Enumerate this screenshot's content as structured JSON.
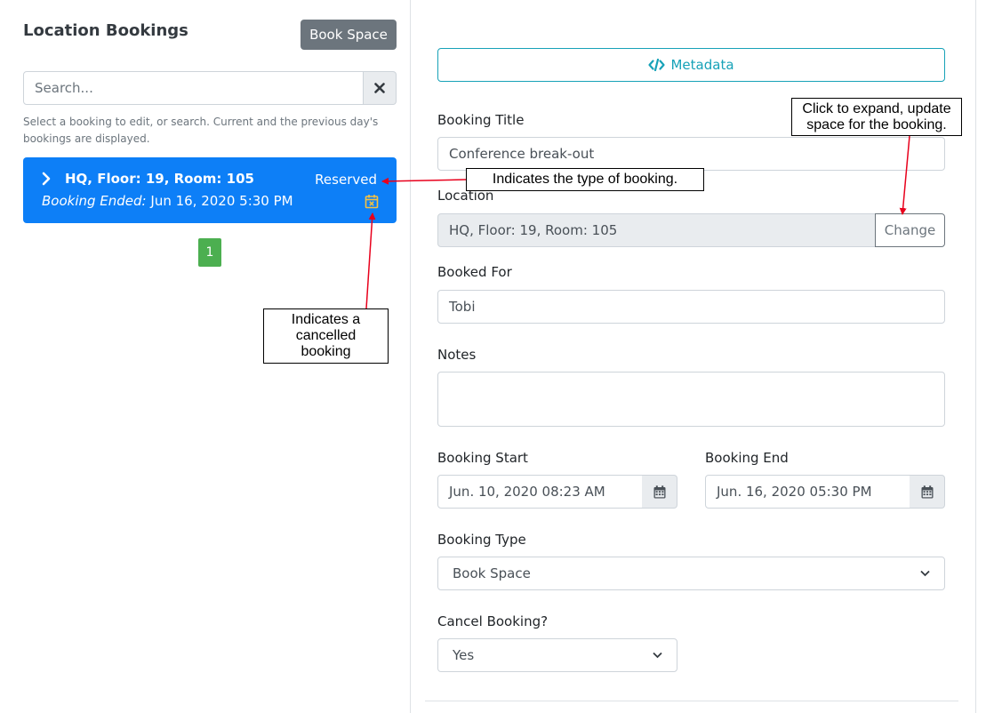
{
  "left": {
    "title": "Location Bookings",
    "book_space_label": "Book Space",
    "search": {
      "placeholder": "Search...",
      "value": ""
    },
    "help_text": "Select a booking to edit, or search. Current and the previous day's bookings are displayed.",
    "booking_card": {
      "location": "HQ, Floor: 19, Room: 105",
      "status": "Reserved",
      "ended_label": "Booking Ended:",
      "ended_value": "Jun 16, 2020 5:30 PM"
    },
    "page_number": "1"
  },
  "right": {
    "metadata_label": "Metadata",
    "booking_title": {
      "label": "Booking Title",
      "value": "Conference break-out"
    },
    "location": {
      "label": "Location",
      "value": "HQ, Floor: 19, Room: 105",
      "change_label": "Change"
    },
    "booked_for": {
      "label": "Booked For",
      "value": "Tobi"
    },
    "notes": {
      "label": "Notes",
      "value": ""
    },
    "booking_start": {
      "label": "Booking Start",
      "value": "Jun. 10, 2020 08:23 AM"
    },
    "booking_end": {
      "label": "Booking End",
      "value": "Jun. 16, 2020 05:30 PM"
    },
    "booking_type": {
      "label": "Booking Type",
      "value": "Book Space"
    },
    "cancel_booking": {
      "label": "Cancel Booking?",
      "value": "Yes"
    }
  },
  "annotations": {
    "expand_note": "Click to expand, update space for the booking.",
    "type_note": "Indicates the type of booking.",
    "cancel_note": "Indicates a cancelled booking"
  },
  "colors": {
    "card_bg": "#0d7ff7",
    "metadata_accent": "#17a2b8",
    "page_badge": "#4caf50",
    "cancel_icon": "#f5c242",
    "arrow": "#e8001c"
  }
}
